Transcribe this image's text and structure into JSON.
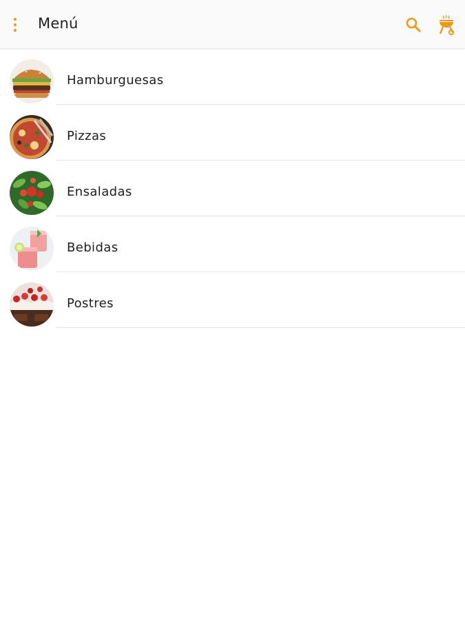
{
  "app_bar": {
    "title": "Menú",
    "overflow_icon": "more-vert-icon",
    "search_icon": "search-icon",
    "grill_icon": "grill-icon",
    "accent_color": "#e89a1d"
  },
  "categories": [
    {
      "label": "Hamburguesas",
      "image": "burger-photo"
    },
    {
      "label": "Pizzas",
      "image": "pizza-photo"
    },
    {
      "label": "Ensaladas",
      "image": "salad-photo"
    },
    {
      "label": "Bebidas",
      "image": "drinks-photo"
    },
    {
      "label": "Postres",
      "image": "desserts-photo"
    }
  ]
}
